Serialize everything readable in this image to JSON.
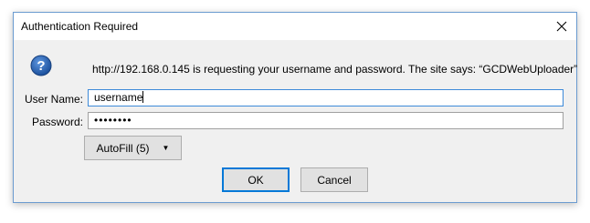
{
  "dialog": {
    "title": "Authentication Required",
    "message": "http://192.168.0.145 is requesting your username and password. The site says: “GCDWebUploader”",
    "username_label": "User Name:",
    "username_value": "username",
    "password_label": "Password:",
    "password_value": "••••••••",
    "autofill_label": "AutoFill (5)",
    "ok_label": "OK",
    "cancel_label": "Cancel"
  },
  "colors": {
    "accent": "#0078d7",
    "question_icon": "#1f5fb4"
  },
  "icons": {
    "close": "close-icon",
    "question": "question-icon",
    "dropdown": "chevron-down-icon"
  }
}
